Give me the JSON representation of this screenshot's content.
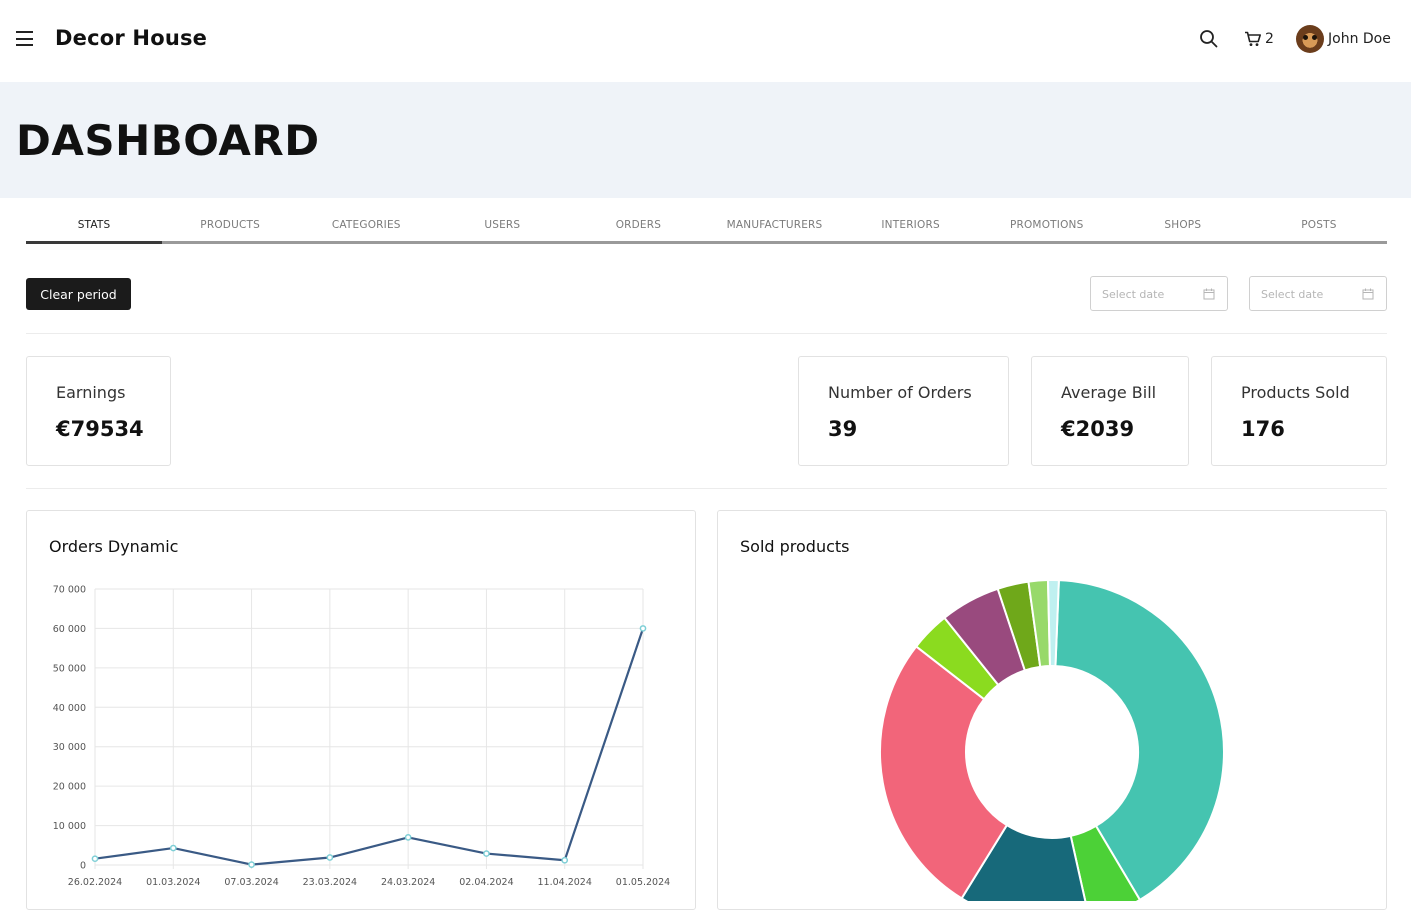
{
  "header": {
    "brand": "Decor House",
    "cart_count": "2",
    "user_name": "John Doe"
  },
  "page_title": "DASHBOARD",
  "tabs": [
    {
      "label": "STATS",
      "active": true
    },
    {
      "label": "PRODUCTS"
    },
    {
      "label": "CATEGORIES"
    },
    {
      "label": "USERS"
    },
    {
      "label": "ORDERS"
    },
    {
      "label": "MANUFACTURERS"
    },
    {
      "label": "INTERIORS"
    },
    {
      "label": "PROMOTIONS"
    },
    {
      "label": "SHOPS"
    },
    {
      "label": "POSTS"
    }
  ],
  "period": {
    "clear_label": "Clear period",
    "start_placeholder": "Select date",
    "end_placeholder": "Select date"
  },
  "stats": {
    "earnings": {
      "label": "Earnings",
      "value": "€79534"
    },
    "orders": {
      "label": "Number of Orders",
      "value": "39"
    },
    "average_bill": {
      "label": "Average Bill",
      "value": "€2039"
    },
    "products_sold": {
      "label": "Products Sold",
      "value": "176"
    }
  },
  "orders_panel": {
    "title": "Orders Dynamic"
  },
  "sold_panel": {
    "title": "Sold products"
  },
  "colors": {
    "line": "#3a5a85",
    "point": "#7ecfd6",
    "dark_button": "#1b1b1b",
    "hero_bg": "#eff3f8"
  },
  "chart_data": [
    {
      "type": "line",
      "title": "Orders Dynamic",
      "x": [
        "26.02.2024",
        "01.03.2024",
        "07.03.2024",
        "23.03.2024",
        "24.03.2024",
        "02.04.2024",
        "11.04.2024",
        "01.05.2024"
      ],
      "y_tick_labels": [
        "0",
        "10 000",
        "20 000",
        "30 000",
        "40 000",
        "50 000",
        "60 000",
        "70 000"
      ],
      "series": [
        {
          "values": [
            1600,
            4300,
            100,
            1900,
            7000,
            2900,
            1200,
            60000
          ]
        }
      ],
      "ylim": [
        0,
        70000
      ],
      "grid": true
    },
    {
      "type": "pie",
      "title": "Sold products",
      "donut": true,
      "slices": [
        {
          "value": 40.5,
          "color": "#45c4b0"
        },
        {
          "value": 5.0,
          "color": "#4cd137"
        },
        {
          "value": 12.2,
          "color": "#17697a"
        },
        {
          "value": 26.5,
          "color": "#f2657a"
        },
        {
          "value": 3.7,
          "color": "#8bdb1f"
        },
        {
          "value": 5.6,
          "color": "#994a7e"
        },
        {
          "value": 2.9,
          "color": "#6fa81a"
        },
        {
          "value": 1.8,
          "color": "#98d96a"
        },
        {
          "value": 1.0,
          "color": "#bff0f0"
        }
      ]
    }
  ]
}
